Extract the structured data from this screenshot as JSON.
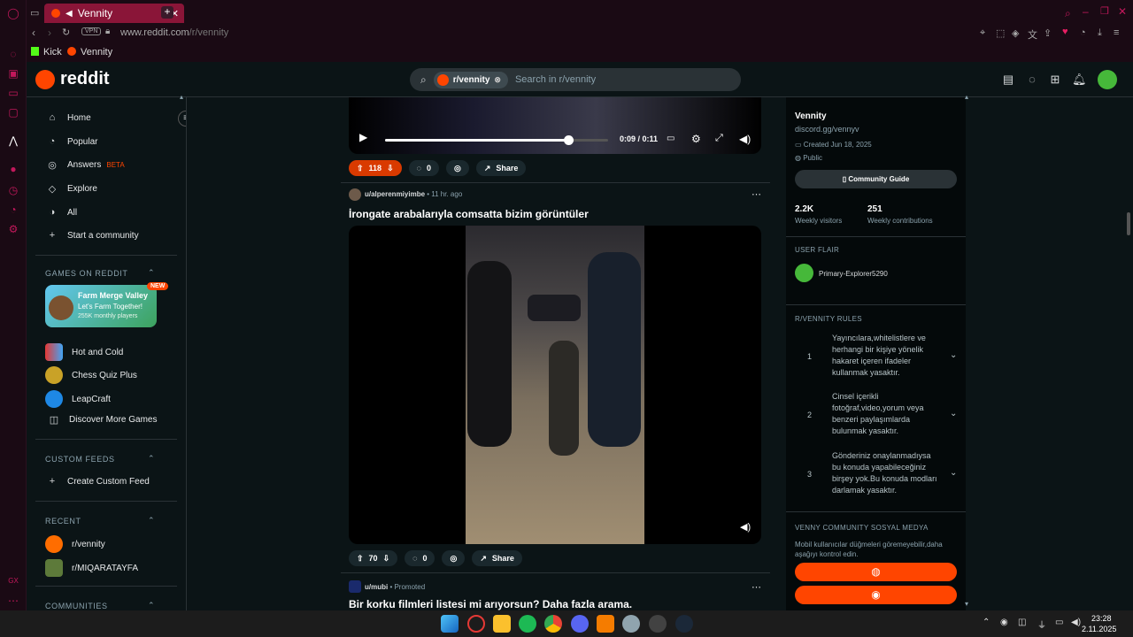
{
  "browser": {
    "tab_title": "Vennity",
    "vpn_label": "VPN",
    "url_domain": "www.reddit.com",
    "url_path": "/r/vennity",
    "bookmarks": [
      "Kick",
      "Vennity"
    ]
  },
  "header": {
    "logo_text": "reddit",
    "search_chip": "r/vennity",
    "search_placeholder": "Search in r/vennity"
  },
  "leftnav": {
    "items": [
      "Home",
      "Popular",
      "Answers",
      "Explore",
      "All",
      "Start a community"
    ],
    "beta_label": "BETA",
    "games_header": "GAMES ON REDDIT",
    "featured_game": {
      "title": "Farm Merge Valley",
      "subtitle": "Let's Farm Together!",
      "meta": "255K monthly players",
      "badge": "NEW"
    },
    "games": [
      "Hot and Cold",
      "Chess Quiz Plus",
      "LeapCraft",
      "Discover More Games"
    ],
    "custom_feeds_header": "CUSTOM FEEDS",
    "create_custom_feed": "Create Custom Feed",
    "recent_header": "RECENT",
    "recent": [
      "r/vennity",
      "r/MIQARATAYFA"
    ],
    "communities_header": "COMMUNITIES"
  },
  "post1": {
    "time": "0:09 / 0:11",
    "progress": 0.82,
    "votes": "118",
    "comments": "0",
    "share": "Share"
  },
  "post2": {
    "author": "u/alperenmiyimbe",
    "time_ago": "11 hr. ago",
    "title": "İrongate arabalarıyla comsatta bizim görüntüler",
    "votes": "70",
    "comments": "0",
    "share": "Share"
  },
  "post3": {
    "author": "u/mubi",
    "promoted": "Promoted",
    "title": "Bir korku filmleri listesi mi arıyorsun? Daha fazla arama."
  },
  "sidebar": {
    "name": "Vennity",
    "link": "discord.gg/vennyv",
    "created": "Created Jun 18, 2025",
    "visibility": "Public",
    "guide_button": "Community Guide",
    "visitors_value": "2.2K",
    "visitors_label": "Weekly visitors",
    "contrib_value": "251",
    "contrib_label": "Weekly contributions",
    "flair_header": "USER FLAIR",
    "flair_user": "Primary-Explorer5290",
    "rules_header": "R/VENNITY RULES",
    "rules": [
      {
        "n": "1",
        "text": "Yayıncılara,whitelistlere ve herhangi bir kişiye yönelik hakaret içeren ifadeler kullanmak yasaktır."
      },
      {
        "n": "2",
        "text": "Cinsel içerikli fotoğraf,video,yorum veya benzeri paylaşımlarda bulunmak yasaktır."
      },
      {
        "n": "3",
        "text": "Gönderiniz onaylanmadıysa bu konuda yapabileceğiniz birşey yok.Bu konuda modları darlamak yasaktır."
      }
    ],
    "social_header": "VENNY COMMUNITY SOSYAL MEDYA",
    "social_note": "Mobil kullanıcılar düğmeleri göremeyebilir,daha aşağıyı kontrol edin."
  },
  "taskbar": {
    "time": "23:28",
    "date": "2.11.2025"
  },
  "colors": {
    "accent": "#ff4500",
    "bg": "#0b1416",
    "opera": "#c2185b"
  }
}
